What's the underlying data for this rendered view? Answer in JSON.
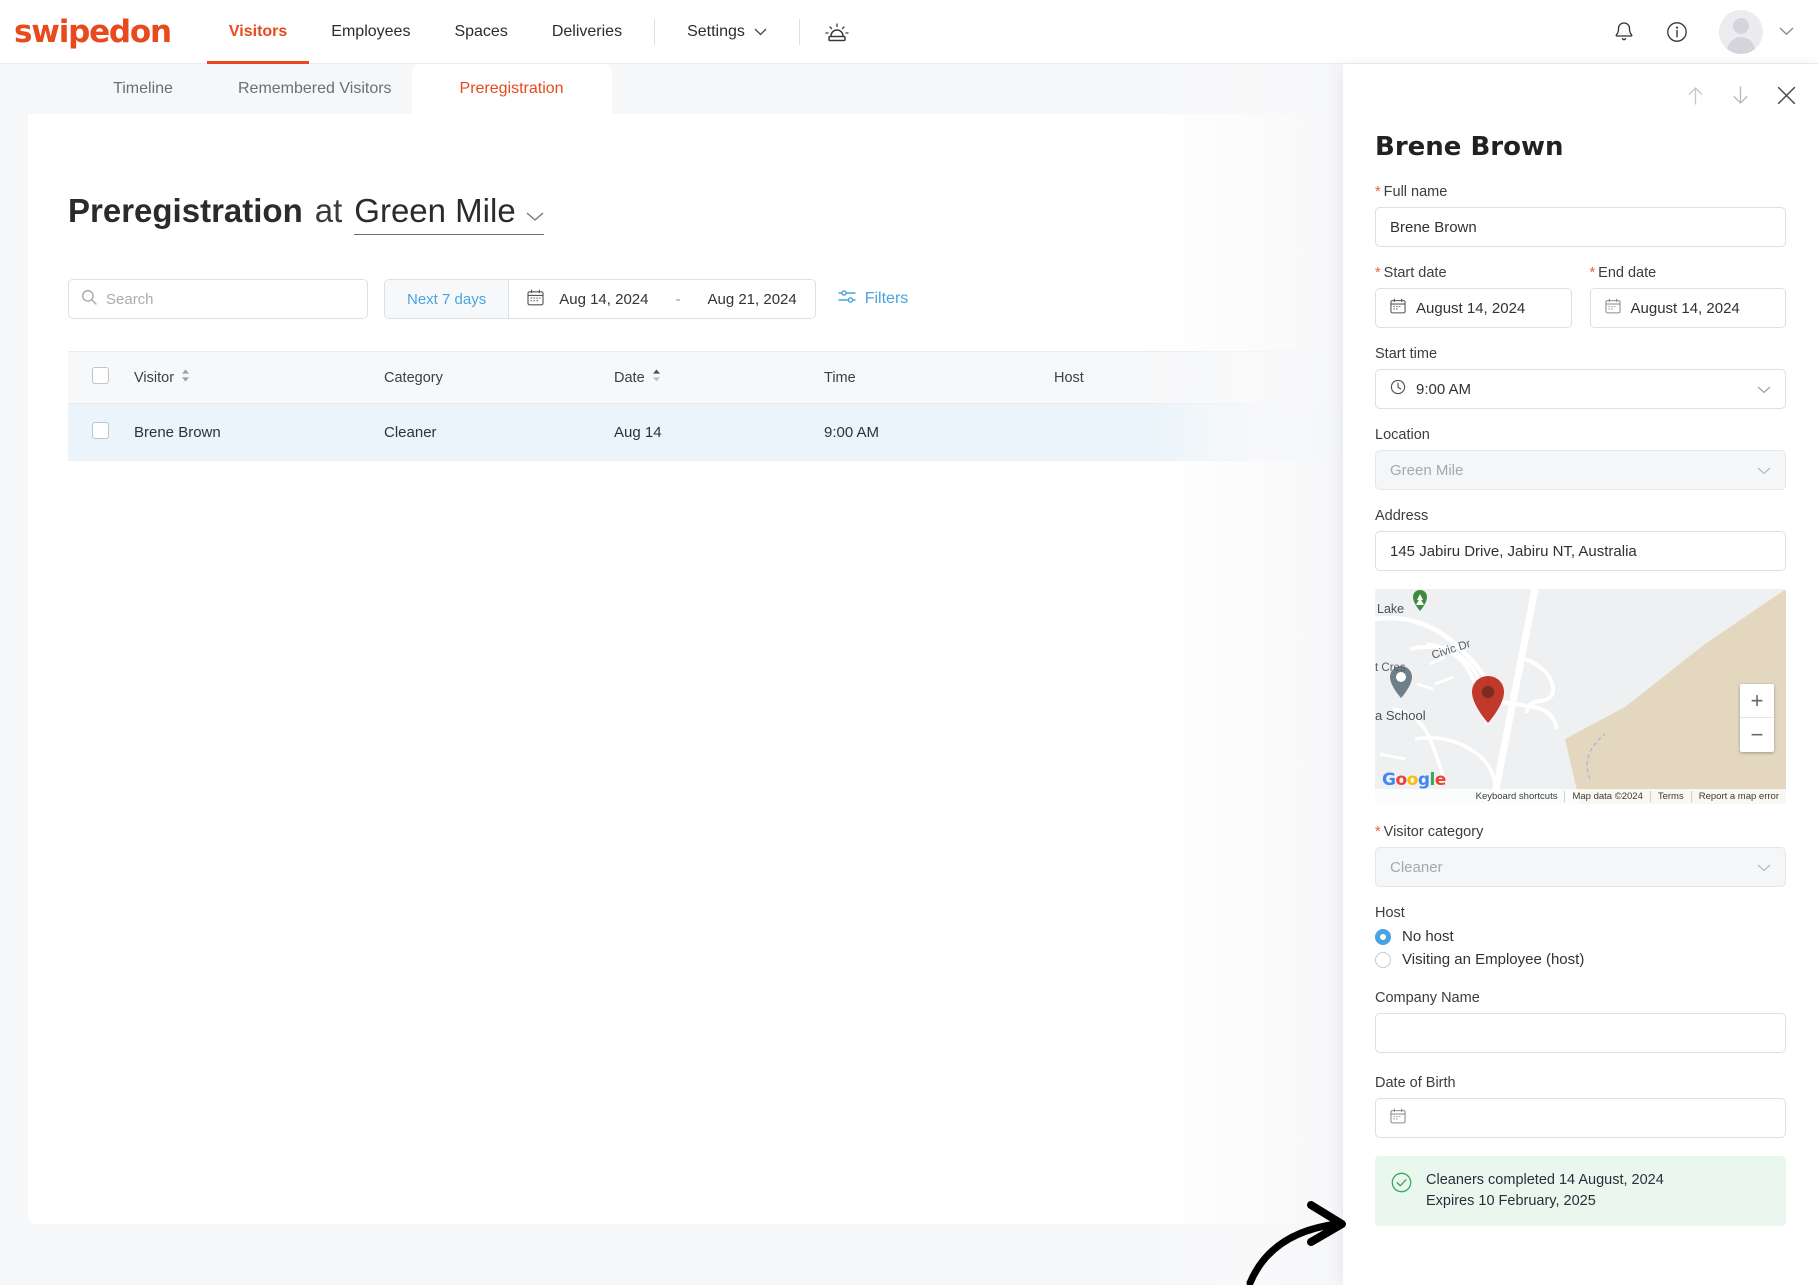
{
  "brand": {
    "name": "swipedon",
    "color": "#e8491d"
  },
  "topnav": {
    "links": [
      {
        "label": "Visitors",
        "active": true
      },
      {
        "label": "Employees",
        "active": false
      },
      {
        "label": "Spaces",
        "active": false
      },
      {
        "label": "Deliveries",
        "active": false
      },
      {
        "label": "Settings",
        "active": false,
        "has_chevron": true
      }
    ],
    "siren_icon": "siren-icon",
    "right_icons": [
      "bell-icon",
      "info-icon",
      "avatar",
      "chevron-down-icon"
    ]
  },
  "tabs": [
    {
      "label": "Timeline",
      "active": false
    },
    {
      "label": "Remembered Visitors",
      "active": false
    },
    {
      "label": "Preregistration",
      "active": true
    }
  ],
  "page_title": {
    "bold": "Preregistration",
    "at": "at",
    "location": "Green Mile"
  },
  "toolbar": {
    "search_placeholder": "Search",
    "search_value": "",
    "date_preset": "Next 7 days",
    "date_from": "Aug 14, 2024",
    "date_dash": "-",
    "date_to": "Aug 21, 2024",
    "filters_label": "Filters"
  },
  "table": {
    "columns": [
      "Visitor",
      "Category",
      "Date",
      "Time",
      "Host"
    ],
    "rows": [
      {
        "visitor": "Brene Brown",
        "category": "Cleaner",
        "date": "Aug 14",
        "time": "9:00 AM",
        "host": ""
      }
    ]
  },
  "panel": {
    "title": "Brene Brown",
    "actions": [
      "up-arrow-icon",
      "down-arrow-icon",
      "close-icon"
    ],
    "fields": {
      "full_name_label": "Full name",
      "full_name_value": "Brene Brown",
      "start_date_label": "Start date",
      "start_date_value": "August 14, 2024",
      "end_date_label": "End date",
      "end_date_value": "August 14, 2024",
      "start_time_label": "Start time",
      "start_time_value": "9:00 AM",
      "location_label": "Location",
      "location_value": "Green Mile",
      "address_label": "Address",
      "address_value": "145 Jabiru Drive, Jabiru NT, Australia",
      "visitor_category_label": "Visitor category",
      "visitor_category_value": "Cleaner",
      "host_label": "Host",
      "host_option_1": "No host",
      "host_option_2": "Visiting an Employee (host)",
      "company_name_label": "Company Name",
      "company_name_value": "",
      "dob_label": "Date of Birth",
      "dob_value": ""
    },
    "map": {
      "labels": [
        "Lake",
        "Civic Dr",
        "t Cres",
        "a School"
      ],
      "logo": "Google",
      "attribution": [
        "Keyboard shortcuts",
        "Map data ©2024",
        "Terms",
        "Report a map error"
      ],
      "zoom_in": "+",
      "zoom_out": "−"
    },
    "notice": {
      "line1": "Cleaners completed 14 August, 2024",
      "line2": "Expires 10 February, 2025",
      "icon": "check-circle-icon",
      "color": "#3aa860"
    }
  }
}
